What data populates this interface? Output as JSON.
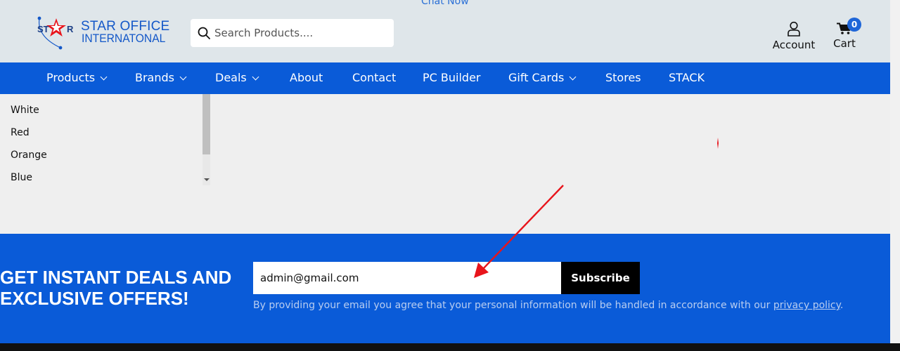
{
  "header": {
    "chat_label": "Chat Now",
    "logo": {
      "line1": "STAR OFFICE",
      "line2": "INTERNATONAL",
      "mark_text_left": "ST",
      "mark_text_right": "R"
    },
    "search": {
      "placeholder": "Search Products...."
    },
    "account_label": "Account",
    "cart_label": "Cart",
    "cart_count": "0"
  },
  "nav": {
    "items": [
      {
        "label": "Products",
        "has_dropdown": true
      },
      {
        "label": "Brands",
        "has_dropdown": true
      },
      {
        "label": "Deals",
        "has_dropdown": true
      },
      {
        "label": "About",
        "has_dropdown": false
      },
      {
        "label": "Contact",
        "has_dropdown": false
      },
      {
        "label": "PC Builder",
        "has_dropdown": false
      },
      {
        "label": "Gift Cards",
        "has_dropdown": true
      },
      {
        "label": "Stores",
        "has_dropdown": false
      },
      {
        "label": "STACK",
        "has_dropdown": false
      }
    ]
  },
  "filter": {
    "colors": [
      "White",
      "Red",
      "Orange",
      "Blue"
    ]
  },
  "newsletter": {
    "heading_line1": "GET INSTANT DEALS AND",
    "heading_line2": "EXCLUSIVE OFFERS!",
    "email_value": "admin@gmail.com",
    "subscribe_label": "Subscribe",
    "disclaimer_text": "By providing your email you agree that your personal information will be handled in accordance with our ",
    "privacy_link": "privacy policy",
    "disclaimer_end": "."
  },
  "colors": {
    "brand_blue": "#0a5bd8",
    "header_bg": "#dfe6ea",
    "annotation_arrow": "#e8141b"
  }
}
